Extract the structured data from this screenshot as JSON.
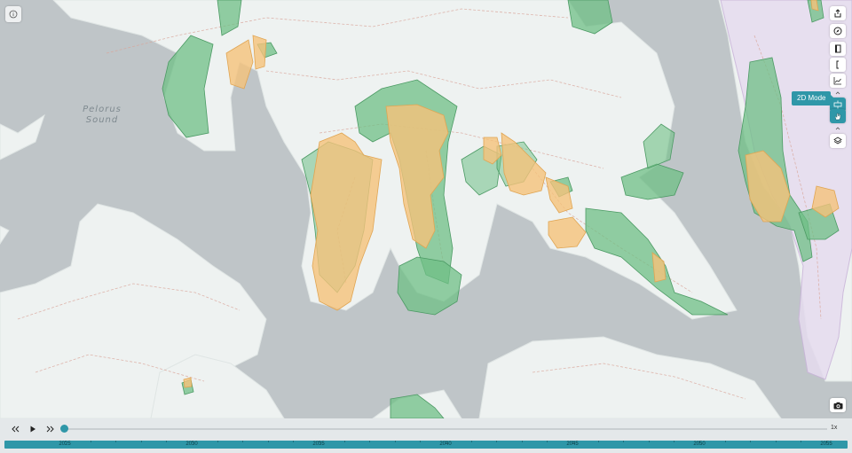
{
  "map": {
    "place_label_line1": "Pelorus",
    "place_label_line2": "Sound",
    "water_color": "#bfc5c8",
    "land_color": "#eef2f1",
    "green_color": "#6fbf86",
    "orange_color": "#f5c27a",
    "purple_color": "#e6dcef"
  },
  "buttons": {
    "info": "info-icon",
    "share": "share-icon",
    "compass": "compass-icon",
    "bookmark": "bookmark-icon",
    "bracket": "bracket-icon",
    "chart": "chart-icon",
    "mode_2d": "2d-mode-icon",
    "hand": "hand-icon",
    "layers": "layers-icon",
    "camera": "camera-icon"
  },
  "tooltip": {
    "text": "2D Mode"
  },
  "timeline": {
    "speed": "1x",
    "current_year": 2025,
    "start_year": 2025,
    "end_year": 2055,
    "years": [
      "2025",
      "2030",
      "2035",
      "2040",
      "2045",
      "2050",
      "2055"
    ]
  }
}
